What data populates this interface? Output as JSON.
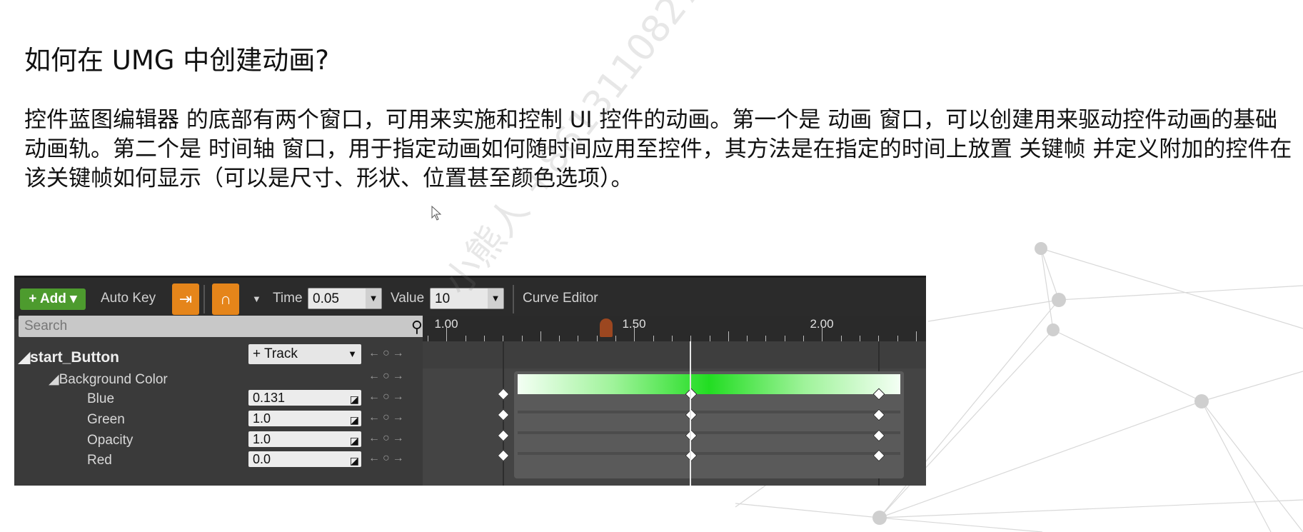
{
  "slide": {
    "title": "如何在 UMG 中创建动画?",
    "body": "控件蓝图编辑器 的底部有两个窗口，可用来实施和控制 UI 控件的动画。第一个是 动画 窗口，可以创建用来驱动控件动画的基础动画轨。第二个是 时间轴 窗口，用于指定动画如何随时间应用至控件，其方法是在指定的时间上放置 关键帧 并定义附加的控件在该关键帧如何显示（可以是尺寸、形状、位置甚至颜色选项）。",
    "watermark": "小熊人 +8613110827"
  },
  "toolbar": {
    "add_label": "+ Add ▾",
    "auto_key_label": "Auto Key",
    "time_label": "Time",
    "time_value": "0.05",
    "value_label": "Value",
    "value_value": "10",
    "curve_editor_label": "Curve Editor",
    "dropdown_arrow": "▼"
  },
  "search": {
    "placeholder": "Search"
  },
  "ruler": {
    "ticks": [
      "1.00",
      "1.50",
      "2.00"
    ]
  },
  "tracks": {
    "object_name": "start_Button",
    "track_button": "+ Track",
    "property": "Background Color",
    "channels": [
      {
        "name": "Blue",
        "value": "0.131"
      },
      {
        "name": "Green",
        "value": "1.0"
      },
      {
        "name": "Opacity",
        "value": "1.0"
      },
      {
        "name": "Red",
        "value": "0.0"
      }
    ],
    "nav_glyphs": "←○→"
  },
  "playhead_time": 1.5,
  "keyframe_times": [
    1.0,
    1.5,
    2.0
  ],
  "colors": {
    "accent_orange": "#e5851a",
    "add_green": "#4d9b2e",
    "keyframe_gradient_mid": "#22dd22"
  }
}
